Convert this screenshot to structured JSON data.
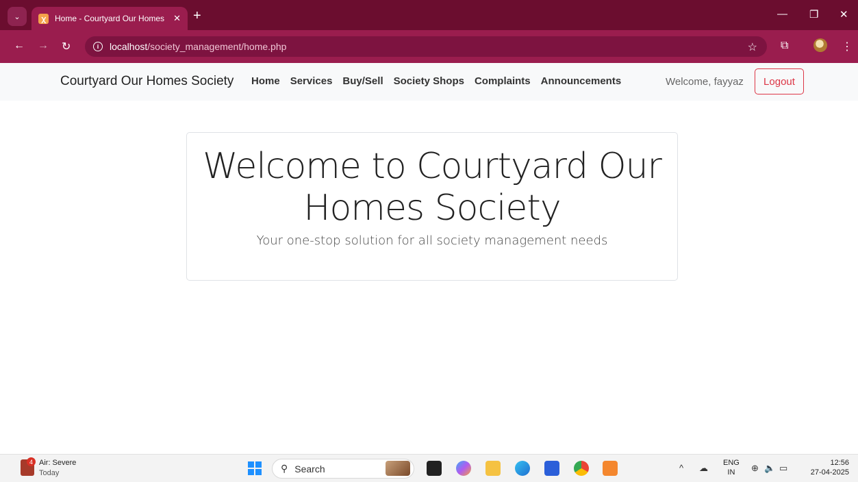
{
  "browser": {
    "tab_title": "Home - Courtyard Our Homes S",
    "tab_close": "✕",
    "new_tab": "+",
    "url_host": "localhost",
    "url_path": "/society_management/home.php"
  },
  "site": {
    "brand": "Courtyard Our Homes Society",
    "nav": [
      "Home",
      "Services",
      "Buy/Sell",
      "Society Shops",
      "Complaints",
      "Announcements"
    ],
    "welcome": "Welcome, fayyaz",
    "logout": "Logout"
  },
  "hero": {
    "title": "Welcome to Courtyard Our Homes Society",
    "subtitle": "Your one-stop solution for all society management needs"
  },
  "taskbar": {
    "weather_badge": "4",
    "weather_title": "Air: Severe",
    "weather_sub": "Today",
    "search_placeholder": "Search",
    "lang_1": "ENG",
    "lang_2": "IN",
    "time": "12:56",
    "date": "27-04-2025"
  },
  "colors": {
    "tab_strip": "#6b0d2f",
    "toolbar": "#9a1d4e",
    "logout_accent": "#dc3545"
  }
}
